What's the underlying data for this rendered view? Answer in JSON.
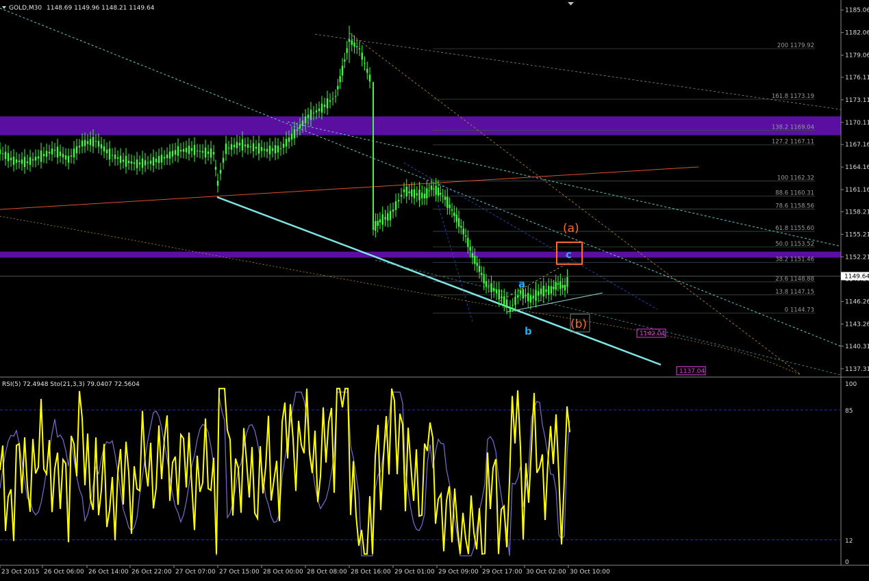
{
  "main_header": {
    "symbol": "GOLD,M30",
    "ohlc": "1148.69 1149.96 1148.21 1149.64"
  },
  "osc_header": {
    "text": "RSI(5) 72.4948  Sto(21,3,3) 79.0407 72.5604"
  },
  "colors": {
    "background": "#000000",
    "bull_candle": "#39ff39",
    "rsi_line": "#ffff00",
    "stoch_line": "#7a6fd0",
    "zone": "#5a0fa0",
    "trend_cyan": "#7fe6e6",
    "trend_red": "#e0502a",
    "wave_orange": "#ff6a2a",
    "wave_blue": "#22a8f0",
    "level_magenta": "#e040e0",
    "grid_line": "#2b2bc8"
  },
  "price_axis": {
    "ticks": [
      "1185.06",
      "1182.06",
      "1179.06",
      "1176.11",
      "1173.11",
      "1170.11",
      "1167.16",
      "1164.16",
      "1161.16",
      "1158.21",
      "1155.21",
      "1152.21",
      "1149.26",
      "1146.26",
      "1143.26",
      "1140.31",
      "1137.31"
    ],
    "current_price": "1149.64"
  },
  "osc_axis": {
    "ticks": [
      "100",
      "85",
      "12",
      "0"
    ]
  },
  "time_axis": {
    "labels": [
      "23 Oct 2015",
      "26 Oct 06:00",
      "26 Oct 14:00",
      "26 Oct 22:00",
      "27 Oct 07:00",
      "27 Oct 15:00",
      "28 Oct 00:00",
      "28 Oct 08:00",
      "28 Oct 16:00",
      "29 Oct 01:00",
      "29 Oct 09:00",
      "29 Oct 17:00",
      "30 Oct 02:00",
      "30 Oct 10:00"
    ]
  },
  "fib_levels": [
    {
      "label": "200 1179.92",
      "price": 1179.92
    },
    {
      "label": "161.8 1173.19",
      "price": 1173.19
    },
    {
      "label": "138.2 1169.04",
      "price": 1169.04
    },
    {
      "label": "127.2 1167.11",
      "price": 1167.11
    },
    {
      "label": "100 1162.32",
      "price": 1162.32
    },
    {
      "label": "88.6 1160.31",
      "price": 1160.31
    },
    {
      "label": "78.6 1158.56",
      "price": 1158.56
    },
    {
      "label": "61.8 1155.60",
      "price": 1155.6
    },
    {
      "label": "50.0 1153.52",
      "price": 1153.52
    },
    {
      "label": "38.2 1151.46",
      "price": 1151.46
    },
    {
      "label": "23.6 1148.88",
      "price": 1148.88
    },
    {
      "label": "13.8 1147.15",
      "price": 1147.15
    },
    {
      "label": "0 1144.73",
      "price": 1144.73
    }
  ],
  "wave_labels": {
    "big_a": "(a)",
    "big_b": "(b)",
    "small_a": "a",
    "small_b": "b",
    "small_c": "c"
  },
  "level_boxes": {
    "level_1": "1142.04",
    "level_2": "1137.04"
  },
  "chart_data": {
    "type": "line",
    "title": "GOLD,M30",
    "x_range": [
      "23 Oct 2015",
      "30 Oct 10:00"
    ],
    "price_range": [
      1136.2,
      1186.4
    ],
    "price_close_path": [
      [
        0,
        1166.2
      ],
      [
        20,
        1165.0
      ],
      [
        40,
        1164.8
      ],
      [
        60,
        1165.6
      ],
      [
        80,
        1166.4
      ],
      [
        100,
        1165.2
      ],
      [
        120,
        1167.3
      ],
      [
        140,
        1167.6
      ],
      [
        160,
        1165.9
      ],
      [
        180,
        1165.0
      ],
      [
        200,
        1164.6
      ],
      [
        220,
        1164.8
      ],
      [
        240,
        1165.4
      ],
      [
        260,
        1166.3
      ],
      [
        280,
        1166.5
      ],
      [
        300,
        1166.1
      ],
      [
        312,
        1166.0
      ],
      [
        318,
        1162.0
      ],
      [
        330,
        1166.6
      ],
      [
        350,
        1167.2
      ],
      [
        370,
        1166.8
      ],
      [
        390,
        1166.4
      ],
      [
        410,
        1166.6
      ],
      [
        430,
        1168.6
      ],
      [
        450,
        1170.9
      ],
      [
        470,
        1172.0
      ],
      [
        490,
        1173.6
      ],
      [
        500,
        1177.0
      ],
      [
        510,
        1181.0
      ],
      [
        525,
        1179.9
      ],
      [
        540,
        1176.0
      ],
      [
        545,
        1156.0
      ],
      [
        555,
        1157.0
      ],
      [
        570,
        1157.7
      ],
      [
        590,
        1161.0
      ],
      [
        605,
        1160.6
      ],
      [
        620,
        1160.3
      ],
      [
        630,
        1161.4
      ],
      [
        640,
        1160.9
      ],
      [
        650,
        1160.0
      ],
      [
        660,
        1158.4
      ],
      [
        670,
        1156.8
      ],
      [
        680,
        1155.0
      ],
      [
        690,
        1152.4
      ],
      [
        700,
        1150.6
      ],
      [
        710,
        1148.6
      ],
      [
        725,
        1147.6
      ],
      [
        740,
        1146.0
      ],
      [
        745,
        1145.2
      ],
      [
        760,
        1147.5
      ],
      [
        775,
        1146.6
      ],
      [
        790,
        1147.6
      ],
      [
        805,
        1147.8
      ],
      [
        815,
        1148.6
      ],
      [
        825,
        1148.1
      ],
      [
        832,
        1149.64
      ]
    ],
    "oscillator_range": [
      0,
      100
    ],
    "oscillator_levels": [
      12,
      85
    ],
    "series": [
      {
        "name": "RSI(5)",
        "last": 72.4948
      },
      {
        "name": "Sto(21,3,3)",
        "main": 79.0407,
        "signal": 72.5604
      }
    ]
  }
}
